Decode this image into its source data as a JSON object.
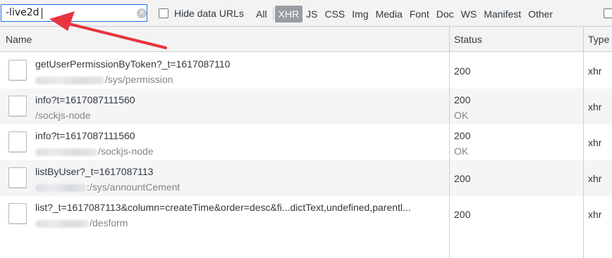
{
  "filter": {
    "value": "-live2d",
    "clear_icon": "clear-icon"
  },
  "hide_data_urls": {
    "label": "Hide data URLs",
    "checked": false
  },
  "type_filters": [
    {
      "label": "All",
      "active": false
    },
    {
      "label": "XHR",
      "active": true
    },
    {
      "label": "JS",
      "active": false
    },
    {
      "label": "CSS",
      "active": false
    },
    {
      "label": "Img",
      "active": false
    },
    {
      "label": "Media",
      "active": false
    },
    {
      "label": "Font",
      "active": false
    },
    {
      "label": "Doc",
      "active": false
    },
    {
      "label": "WS",
      "active": false
    },
    {
      "label": "Manifest",
      "active": false
    },
    {
      "label": "Other",
      "active": false
    }
  ],
  "columns": {
    "name": "Name",
    "status": "Status",
    "type": "Type"
  },
  "requests": [
    {
      "name": "getUserPermissionByToken?_t=1617087110",
      "path": "/sys/permission",
      "status": "200",
      "status_text": "",
      "type": "xhr"
    },
    {
      "name": "info?t=1617087111560",
      "path": "/sockjs-node",
      "status": "200",
      "status_text": "OK",
      "type": "xhr"
    },
    {
      "name": "info?t=1617087111560",
      "path": "/sockjs-node",
      "status": "200",
      "status_text": "OK",
      "type": "xhr"
    },
    {
      "name": "listByUser?_t=1617087113",
      "path": ":/sys/annountCement",
      "status": "200",
      "status_text": "",
      "type": "xhr"
    },
    {
      "name": "list?_t=1617087113&column=createTime&order=desc&fi...dictText,undefined,parentl...",
      "path": "/desform",
      "status": "200",
      "status_text": "",
      "type": "xhr"
    }
  ],
  "annotation": {
    "color": "#e8343f",
    "icon": "red-arrow-icon"
  }
}
